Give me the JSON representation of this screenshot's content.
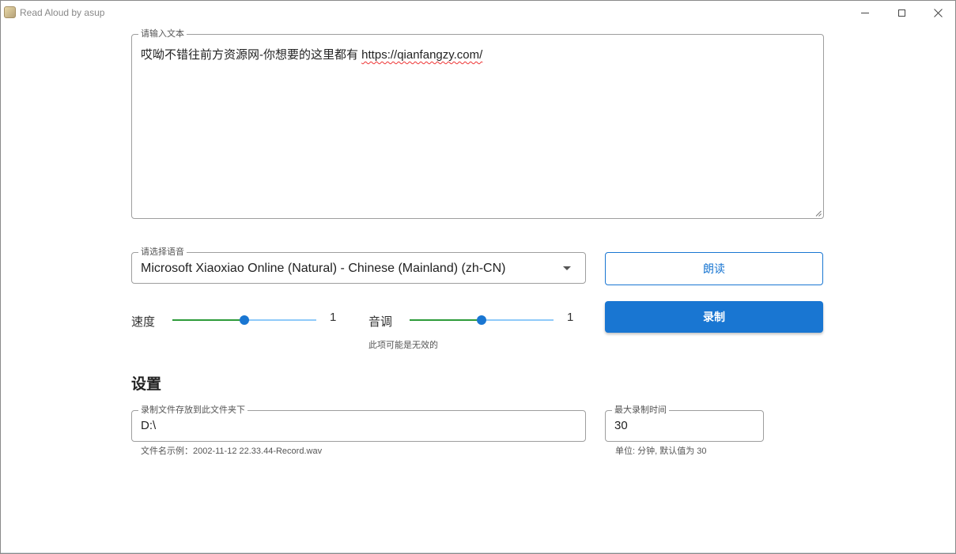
{
  "window": {
    "title": "Read Aloud by asup"
  },
  "text_input": {
    "legend": "请输入文本",
    "text_prefix": "哎呦不错往前方资源网-你想要的这里都有 ",
    "text_url": "https://qianfangzy.com/"
  },
  "voice_select": {
    "legend": "请选择语音",
    "value": "Microsoft Xiaoxiao Online (Natural) - Chinese (Mainland) (zh-CN)"
  },
  "buttons": {
    "read_label": "朗读",
    "record_label": "录制"
  },
  "speed": {
    "label": "速度",
    "value": "1",
    "level": 0.5
  },
  "pitch": {
    "label": "音调",
    "value": "1",
    "level": 0.5,
    "hint": "此项可能是无效的"
  },
  "settings": {
    "title": "设置",
    "folder": {
      "legend": "录制文件存放到此文件夹下",
      "value": "D:\\",
      "hint": "文件名示例：2002-11-12 22.33.44-Record.wav"
    },
    "max_time": {
      "legend": "最大录制时间",
      "value": "30",
      "hint": "单位: 分钟, 默认值为 30"
    }
  },
  "colors": {
    "accent": "#1976d2",
    "slider_fill": "#2e9b3a",
    "slider_rail": "#90caf9"
  }
}
